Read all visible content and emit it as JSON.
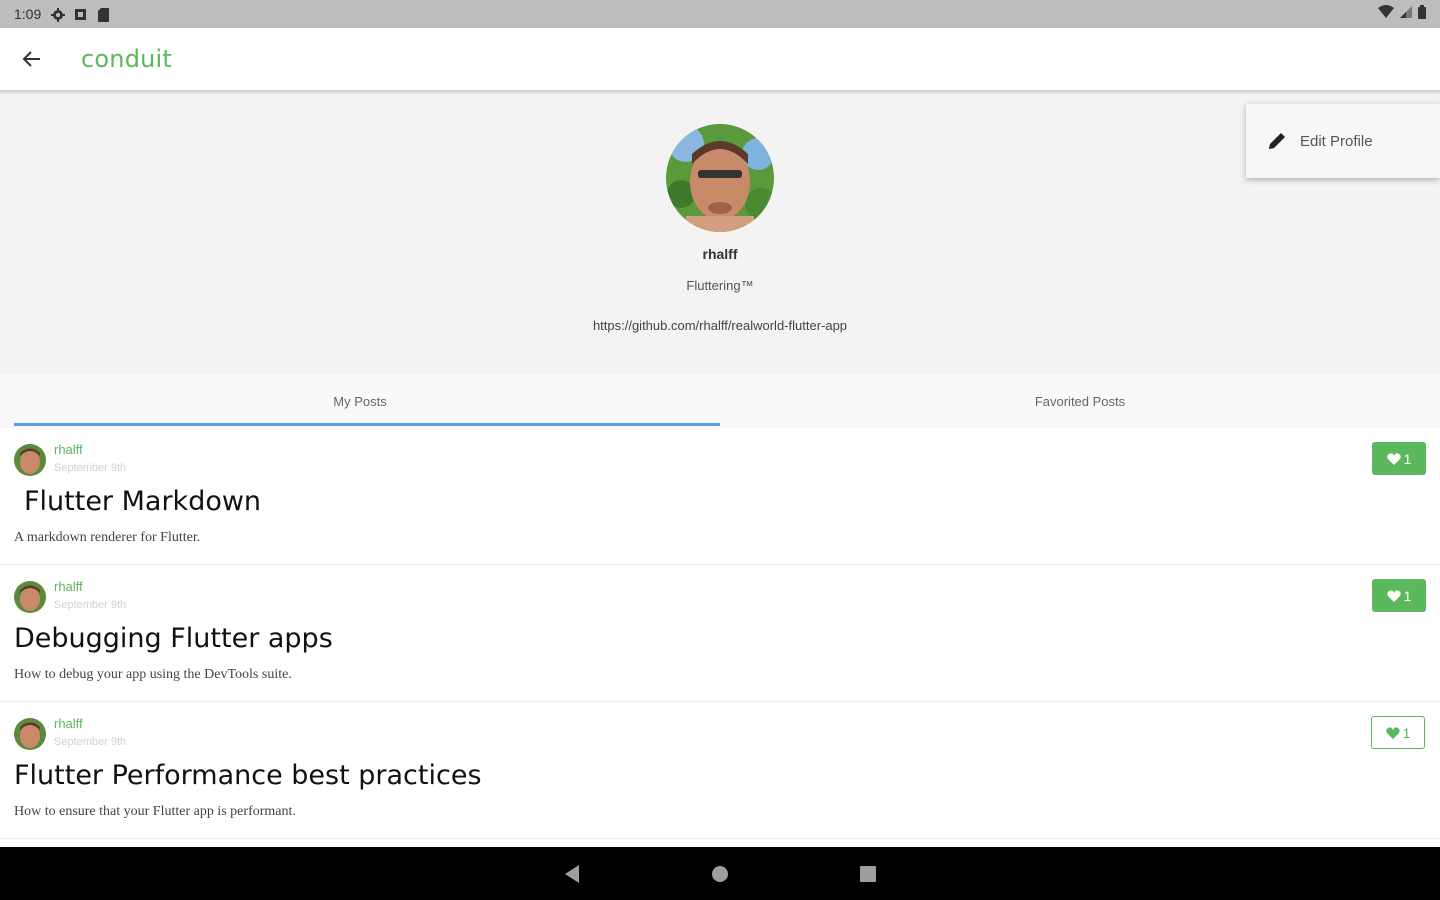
{
  "status_bar": {
    "time": "1:09",
    "icons": [
      "settings-gear-icon",
      "sim-icon",
      "sd-card-icon"
    ],
    "right_icons": [
      "wifi-icon",
      "cell-signal-icon",
      "battery-icon"
    ]
  },
  "app_bar": {
    "title": "conduit",
    "back_icon": "arrow-back-icon"
  },
  "profile": {
    "username": "rhalff",
    "bio": "Fluttering™",
    "link": "https://github.com/rhalff/realworld-flutter-app"
  },
  "menu": {
    "edit_label": "Edit Profile",
    "edit_icon": "pencil-icon"
  },
  "tabs": [
    {
      "label": "My Posts",
      "active": true
    },
    {
      "label": "Favorited Posts",
      "active": false
    }
  ],
  "posts": [
    {
      "author": "rhalff",
      "date": "September 9th",
      "title": "Flutter Markdown",
      "description": "A markdown renderer for Flutter.",
      "favorites": "1",
      "favorited": true
    },
    {
      "author": "rhalff",
      "date": "September 9th",
      "title": "Debugging Flutter apps",
      "description": "How to debug your app using the DevTools suite.",
      "favorites": "1",
      "favorited": true
    },
    {
      "author": "rhalff",
      "date": "September 9th",
      "title": "Flutter Performance best practices",
      "description": "How to ensure that your Flutter app is performant.",
      "favorites": "1",
      "favorited": false
    }
  ],
  "nav_bar": [
    "back-triangle-icon",
    "home-circle-icon",
    "recents-square-icon"
  ],
  "colors": {
    "accent": "#5cb85c",
    "tab_indicator": "#5b9bf0",
    "header_bg": "#f3f3f3"
  }
}
